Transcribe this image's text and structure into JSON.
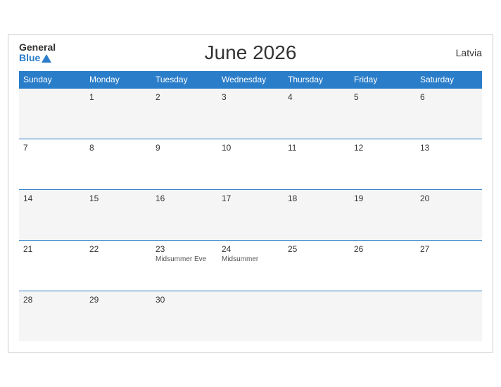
{
  "header": {
    "logo_general": "General",
    "logo_blue": "Blue",
    "title": "June 2026",
    "region": "Latvia"
  },
  "weekdays": [
    "Sunday",
    "Monday",
    "Tuesday",
    "Wednesday",
    "Thursday",
    "Friday",
    "Saturday"
  ],
  "weeks": [
    [
      {
        "day": "",
        "event": ""
      },
      {
        "day": "1",
        "event": ""
      },
      {
        "day": "2",
        "event": ""
      },
      {
        "day": "3",
        "event": ""
      },
      {
        "day": "4",
        "event": ""
      },
      {
        "day": "5",
        "event": ""
      },
      {
        "day": "6",
        "event": ""
      }
    ],
    [
      {
        "day": "7",
        "event": ""
      },
      {
        "day": "8",
        "event": ""
      },
      {
        "day": "9",
        "event": ""
      },
      {
        "day": "10",
        "event": ""
      },
      {
        "day": "11",
        "event": ""
      },
      {
        "day": "12",
        "event": ""
      },
      {
        "day": "13",
        "event": ""
      }
    ],
    [
      {
        "day": "14",
        "event": ""
      },
      {
        "day": "15",
        "event": ""
      },
      {
        "day": "16",
        "event": ""
      },
      {
        "day": "17",
        "event": ""
      },
      {
        "day": "18",
        "event": ""
      },
      {
        "day": "19",
        "event": ""
      },
      {
        "day": "20",
        "event": ""
      }
    ],
    [
      {
        "day": "21",
        "event": ""
      },
      {
        "day": "22",
        "event": ""
      },
      {
        "day": "23",
        "event": "Midsummer Eve"
      },
      {
        "day": "24",
        "event": "Midsummer"
      },
      {
        "day": "25",
        "event": ""
      },
      {
        "day": "26",
        "event": ""
      },
      {
        "day": "27",
        "event": ""
      }
    ],
    [
      {
        "day": "28",
        "event": ""
      },
      {
        "day": "29",
        "event": ""
      },
      {
        "day": "30",
        "event": ""
      },
      {
        "day": "",
        "event": ""
      },
      {
        "day": "",
        "event": ""
      },
      {
        "day": "",
        "event": ""
      },
      {
        "day": "",
        "event": ""
      }
    ]
  ]
}
